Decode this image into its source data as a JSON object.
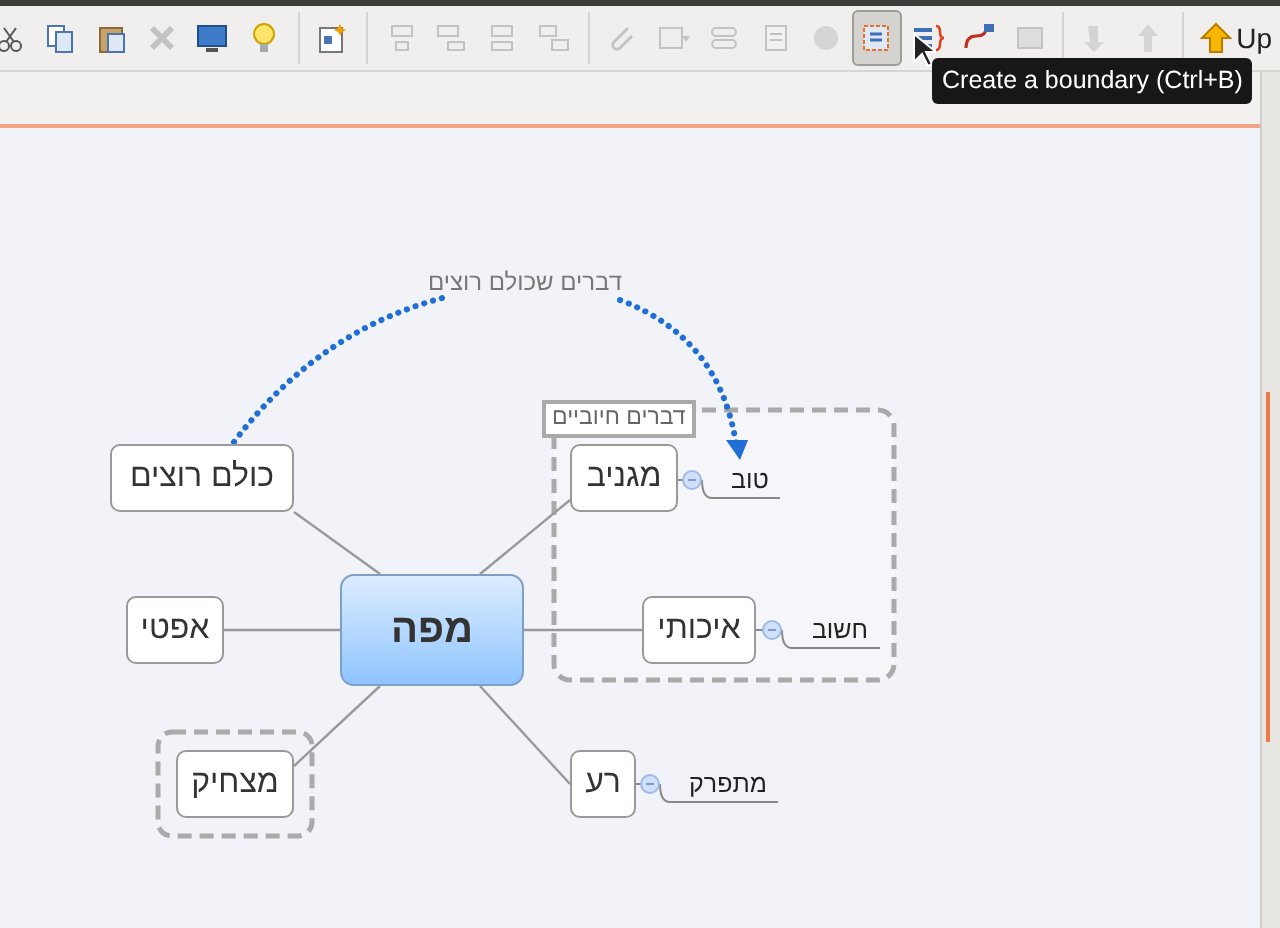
{
  "toolbar_groups": [
    [
      {
        "kind": "cut",
        "disabled": false,
        "selected": false
      },
      {
        "kind": "copy",
        "disabled": false,
        "selected": false
      },
      {
        "kind": "paste",
        "disabled": false,
        "selected": false
      },
      {
        "kind": "delete",
        "disabled": true,
        "selected": false
      },
      {
        "kind": "present",
        "disabled": false,
        "selected": false
      },
      {
        "kind": "idea",
        "disabled": false,
        "selected": false
      }
    ],
    [
      {
        "kind": "insert",
        "disabled": false,
        "selected": false
      }
    ],
    [
      {
        "kind": "topic",
        "disabled": true,
        "selected": false
      },
      {
        "kind": "subtopic",
        "disabled": true,
        "selected": false
      },
      {
        "kind": "callout",
        "disabled": true,
        "selected": false
      },
      {
        "kind": "floating",
        "disabled": true,
        "selected": false
      }
    ],
    [
      {
        "kind": "attach",
        "disabled": true,
        "selected": false
      },
      {
        "kind": "image",
        "disabled": true,
        "selected": false
      },
      {
        "kind": "label",
        "disabled": true,
        "selected": false
      },
      {
        "kind": "notes",
        "disabled": true,
        "selected": false
      },
      {
        "kind": "web",
        "disabled": true,
        "selected": false
      },
      {
        "kind": "boundary",
        "disabled": false,
        "selected": true
      },
      {
        "kind": "summary",
        "disabled": false,
        "selected": false
      },
      {
        "kind": "relationship",
        "disabled": false,
        "selected": false
      },
      {
        "kind": "grid",
        "disabled": true,
        "selected": false
      }
    ],
    [
      {
        "kind": "drill-down",
        "disabled": true,
        "selected": false
      },
      {
        "kind": "drill-up",
        "disabled": true,
        "selected": false
      }
    ],
    [
      {
        "kind": "up",
        "label": "Up",
        "disabled": false,
        "selected": false
      }
    ]
  ],
  "tooltip": "Create a boundary (Ctrl+B)",
  "central_topic": "מפה",
  "main_topics": [
    {
      "label": "כולם רוצים"
    },
    {
      "label": "אפטי"
    },
    {
      "label": "מצחיק",
      "boundary": true
    },
    {
      "label": "מגניב",
      "expanded": true,
      "children": [
        {
          "label": "טוב"
        }
      ]
    },
    {
      "label": "איכותי",
      "expanded": true,
      "children": [
        {
          "label": "חשוב"
        }
      ]
    },
    {
      "label": "רע",
      "expanded": true,
      "children": [
        {
          "label": "מתפרק"
        }
      ]
    }
  ],
  "group_boundary": {
    "label": "דברים חיוביים"
  },
  "relationship": {
    "label": "דברים שכולם רוצים"
  }
}
